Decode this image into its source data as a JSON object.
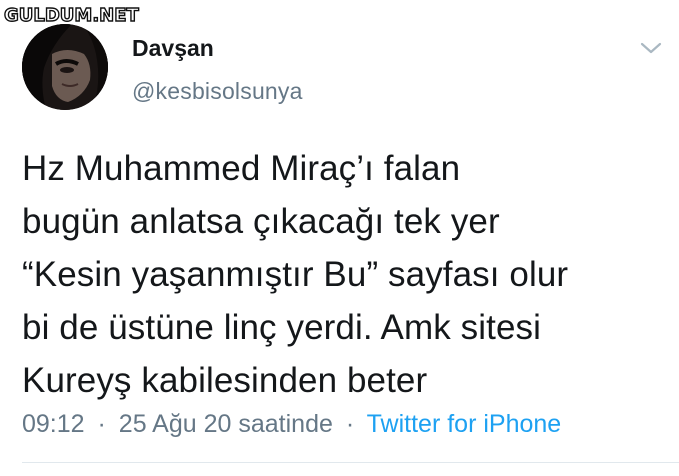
{
  "watermark": {
    "text": "GULDUM.NET"
  },
  "author": {
    "name": "Davşan",
    "handle": "@kesbisolsunya"
  },
  "menu": {
    "icon": "chevron-down-icon"
  },
  "tweet": {
    "lines": [
      "Hz Muhammed Miraç’ı falan",
      "bugün anlatsa çıkacağı tek yer",
      "“Kesin yaşanmıştır Bu” sayfası olur",
      "bi de üstüne linç yerdi. Amk sitesi",
      "Kureyş kabilesinden beter"
    ]
  },
  "meta": {
    "time": "09:12",
    "separator": "·",
    "date": "25 Ağu 20 saatinde",
    "source": "Twitter for iPhone"
  },
  "colors": {
    "text": "#14171a",
    "secondary": "#657786",
    "link": "#1da1f2",
    "divider": "#e1e8ed"
  }
}
